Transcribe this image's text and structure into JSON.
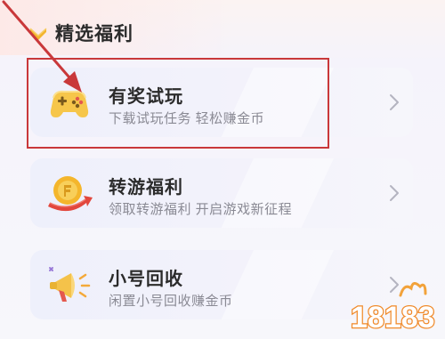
{
  "section": {
    "title": "精选福利",
    "icon": "chevron-badge-icon"
  },
  "cards": [
    {
      "title": "有奖试玩",
      "subtitle": "下载试玩任务 轻松赚金币",
      "icon": "gamepad-icon"
    },
    {
      "title": "转游福利",
      "subtitle": "领取转游福利 开启游戏新征程",
      "icon": "coin-transfer-icon"
    },
    {
      "title": "小号回收",
      "subtitle": "闲置小号回收赚金币",
      "icon": "megaphone-icon"
    }
  ],
  "annotation": {
    "color": "#c9383a"
  },
  "watermark": {
    "text": "18183"
  },
  "colors": {
    "title": "#2b2b2b",
    "subtitle": "#8a8a94",
    "card_bg": "#eef0fb",
    "accent_yellow": "#f5b933"
  }
}
